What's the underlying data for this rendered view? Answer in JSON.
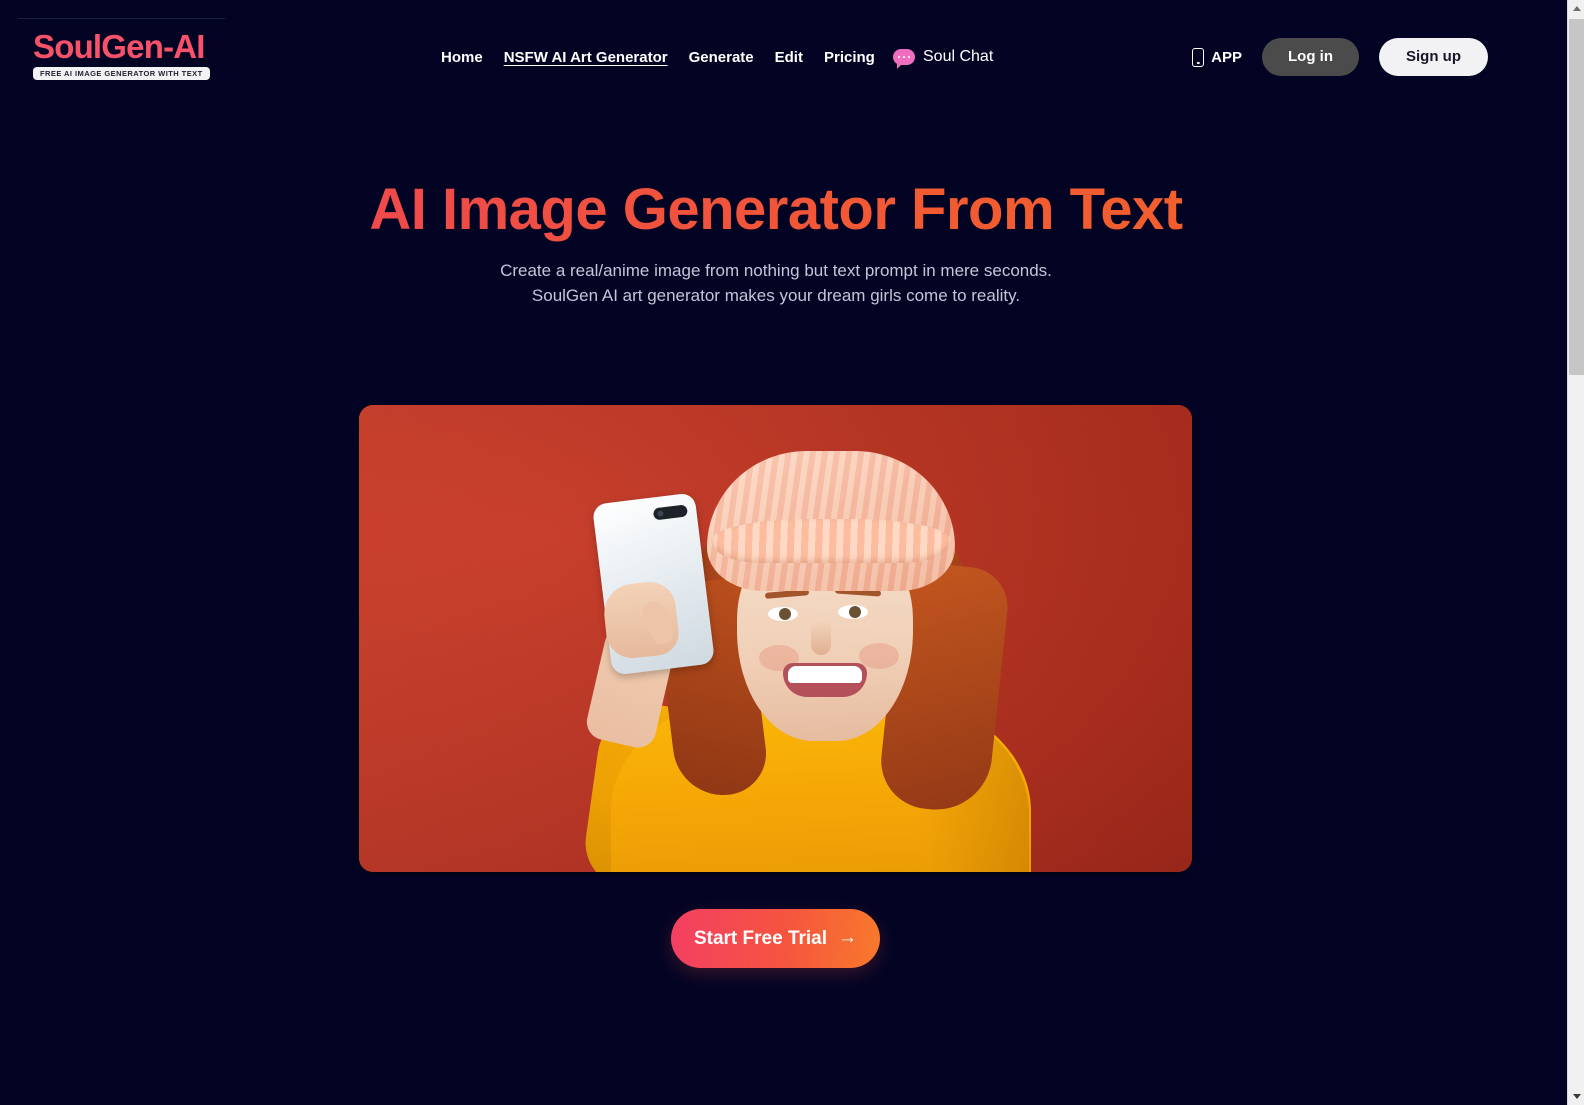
{
  "brand": {
    "logo_text": "SoulGen-AI",
    "logo_tagline": "FREE AI IMAGE GENERATOR WITH TEXT",
    "accent_pink": "#f8526a",
    "accent_orange": "#f4622a",
    "page_background": "#030424"
  },
  "nav": {
    "items": [
      {
        "label": "Home",
        "active": false
      },
      {
        "label": "NSFW AI Art Generator",
        "active": true
      },
      {
        "label": "Generate",
        "active": false
      },
      {
        "label": "Edit",
        "active": false
      },
      {
        "label": "Pricing",
        "active": false
      }
    ],
    "soul_chat_label": "Soul Chat",
    "soul_chat_icon": "chat-bubble-icon",
    "soul_chat_color": "#f06ec0"
  },
  "header_actions": {
    "app_label": "APP",
    "app_icon": "mobile-phone-icon",
    "login_label": "Log in",
    "signup_label": "Sign up"
  },
  "hero": {
    "title": "AI Image Generator From Text",
    "subtitle_line1": "Create a real/anime image from nothing but text prompt in mere seconds.",
    "subtitle_line2": "SoulGen AI art generator makes your dream girls come to reality.",
    "media_alt": "Smiling woman with red curly hair wearing a peach knit beanie and yellow sweater taking a selfie on a red background",
    "media_background_color": "#c03425",
    "cta_label": "Start Free Trial",
    "cta_arrow": "→"
  },
  "scrollbar": {
    "up_arrow": "scroll-up-arrow",
    "down_arrow": "scroll-down-arrow"
  }
}
